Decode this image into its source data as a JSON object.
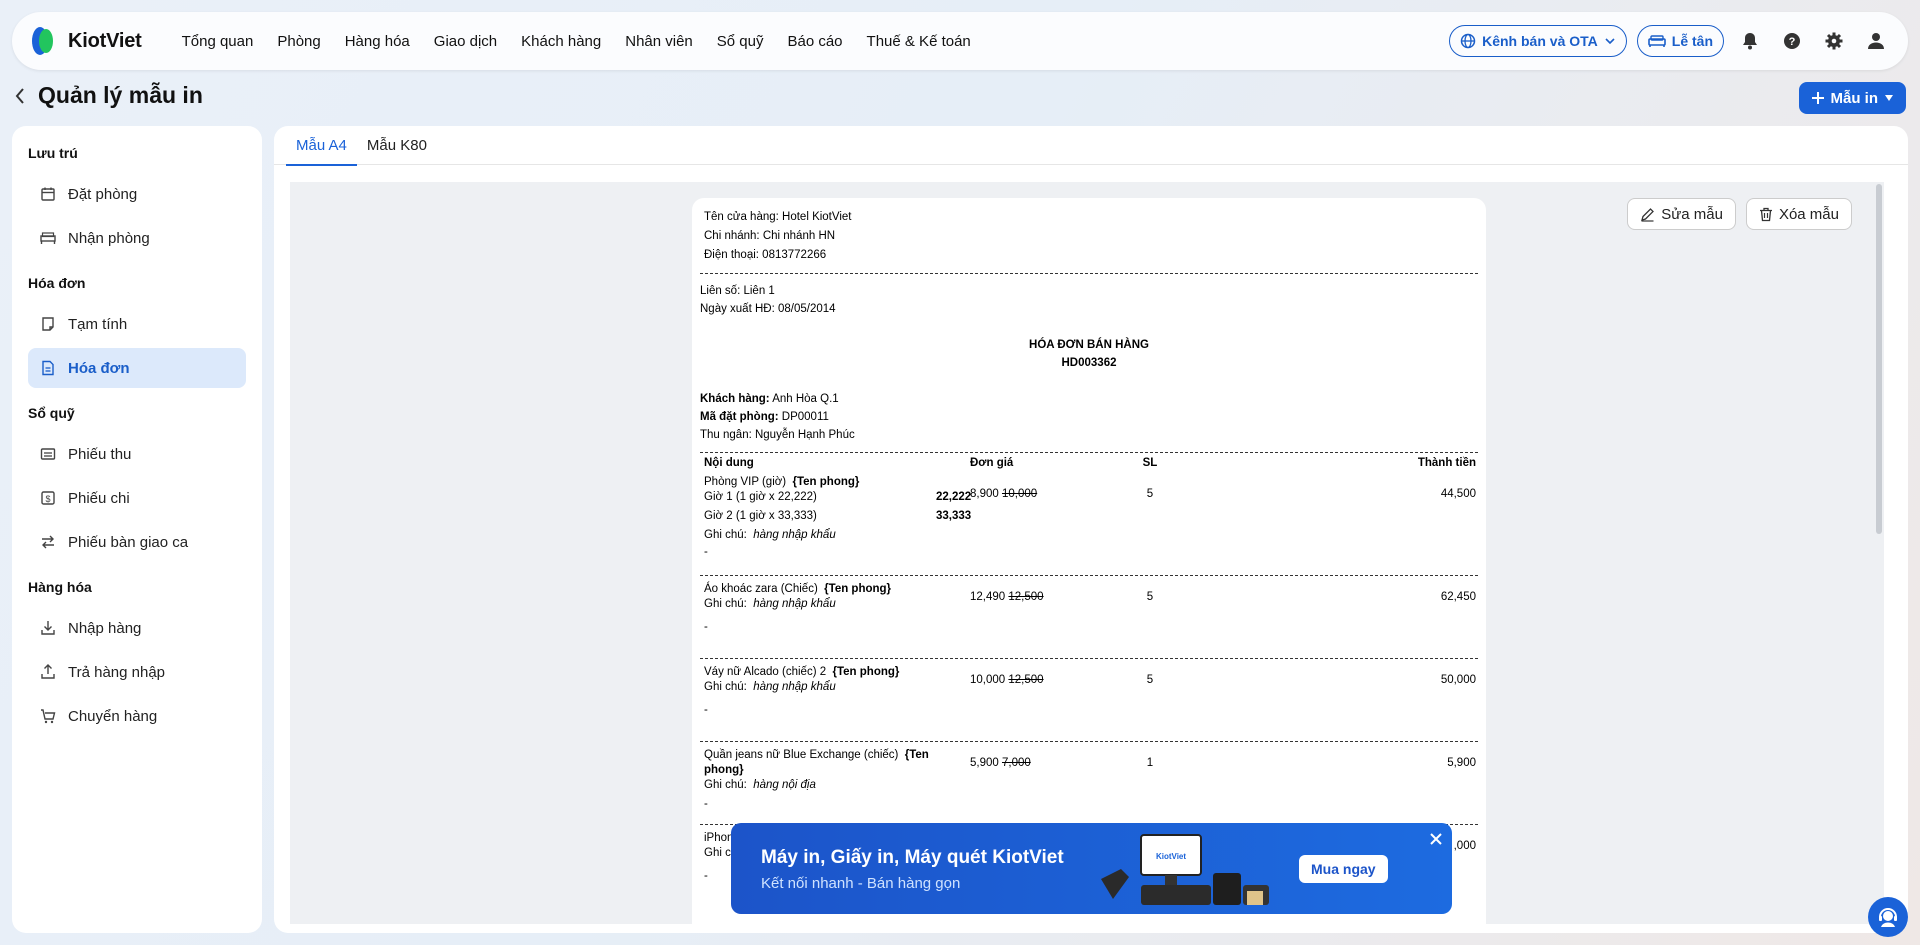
{
  "brand": {
    "name": "KiotViet"
  },
  "nav": [
    "Tổng quan",
    "Phòng",
    "Hàng hóa",
    "Giao dịch",
    "Khách hàng",
    "Nhân viên",
    "Sổ quỹ",
    "Báo cáo",
    "Thuế & Kế toán"
  ],
  "header": {
    "channel_label": "Kênh bán và OTA",
    "reception_label": "Lễ tân"
  },
  "page": {
    "title": "Quản lý mẫu in",
    "add_label": "Mẫu in"
  },
  "sidebar": {
    "groups": [
      {
        "title": "Lưu trú",
        "items": [
          {
            "label": "Đặt phòng",
            "icon": "calendar-icon"
          },
          {
            "label": "Nhận phòng",
            "icon": "bed-icon"
          }
        ]
      },
      {
        "title": "Hóa đơn",
        "items": [
          {
            "label": "Tạm tính",
            "icon": "note-icon"
          },
          {
            "label": "Hóa đơn",
            "icon": "invoice-icon"
          }
        ]
      },
      {
        "title": "Sổ quỹ",
        "items": [
          {
            "label": "Phiếu thu",
            "icon": "receipt-icon"
          },
          {
            "label": "Phiếu chi",
            "icon": "payment-icon"
          },
          {
            "label": "Phiếu bàn giao ca",
            "icon": "swap-icon"
          }
        ]
      },
      {
        "title": "Hàng hóa",
        "items": [
          {
            "label": "Nhập hàng",
            "icon": "import-icon"
          },
          {
            "label": "Trả hàng nhập",
            "icon": "return-icon"
          },
          {
            "label": "Chuyển hàng",
            "icon": "transfer-icon"
          }
        ]
      }
    ],
    "active": "Hóa đơn"
  },
  "tabs": [
    "Mẫu A4",
    "Mẫu K80"
  ],
  "actions": {
    "edit": "Sửa mẫu",
    "delete": "Xóa mẫu"
  },
  "invoice": {
    "store": "Tên cửa hàng: Hotel KiotViet",
    "branch": "Chi nhánh: Chi nhánh HN",
    "phone": "Điện thoại: 0813772266",
    "copy": "Liên số: Liên 1",
    "date": "Ngày xuất HĐ: 08/05/2014",
    "title": "HÓA ĐƠN BÁN HÀNG",
    "code": "HD003362",
    "customer_label": "Khách hàng:",
    "customer": "Anh Hòa Q.1",
    "booking_label": "Mã đặt phòng:",
    "booking": "DP00011",
    "cashier": "Thu ngân: Nguyễn Hạnh Phúc",
    "cols": [
      "Nội dung",
      "Đơn giá",
      "SL",
      "Thành tiền"
    ],
    "items": [
      {
        "name": "Phòng VIP (giờ)",
        "tag": "{Ten phong}",
        "sub1": "Giờ 1 (1 giờ x 22,222)",
        "sub1v": "22,222",
        "sub2": "Giờ 2 (1 giờ x 33,333)",
        "sub2v": "33,333",
        "note_label": "Ghi chú:",
        "note": "hàng nhập khẩu",
        "price": "8,900",
        "old": "10,000",
        "qty": "5",
        "total": "44,500"
      },
      {
        "name": "Áo khoác zara (Chiếc)",
        "tag": "{Ten phong}",
        "note_label": "Ghi chú:",
        "note": "hàng nhập khẩu",
        "price": "12,490",
        "old": "12,500",
        "qty": "5",
        "total": "62,450"
      },
      {
        "name": "Váy nữ Alcado (chiếc) 2",
        "tag": "{Ten phong}",
        "note_label": "Ghi chú:",
        "note": "hàng nhập khẩu",
        "price": "10,000",
        "old": "12,500",
        "qty": "5",
        "total": "50,000"
      },
      {
        "name": "Quần jeans nữ Blue Exchange (chiếc)",
        "tag": "{Ten phong}",
        "note_label": "Ghi chú:",
        "note": "hàng nội địa",
        "price": "5,900",
        "old": "7,000",
        "qty": "1",
        "total": "5,900"
      },
      {
        "name": "iPhon",
        "note_label": "Ghi c",
        "total": ",000"
      }
    ],
    "dash": "-"
  },
  "banner": {
    "title": "Máy in, Giấy in, Máy quét KiotViet",
    "subtitle": "Kết nối nhanh - Bán hàng gọn",
    "cta": "Mua ngay",
    "device_label": "KiotViet"
  },
  "colors": {
    "primary": "#1a62d8",
    "active_bg": "#dce9fb"
  }
}
